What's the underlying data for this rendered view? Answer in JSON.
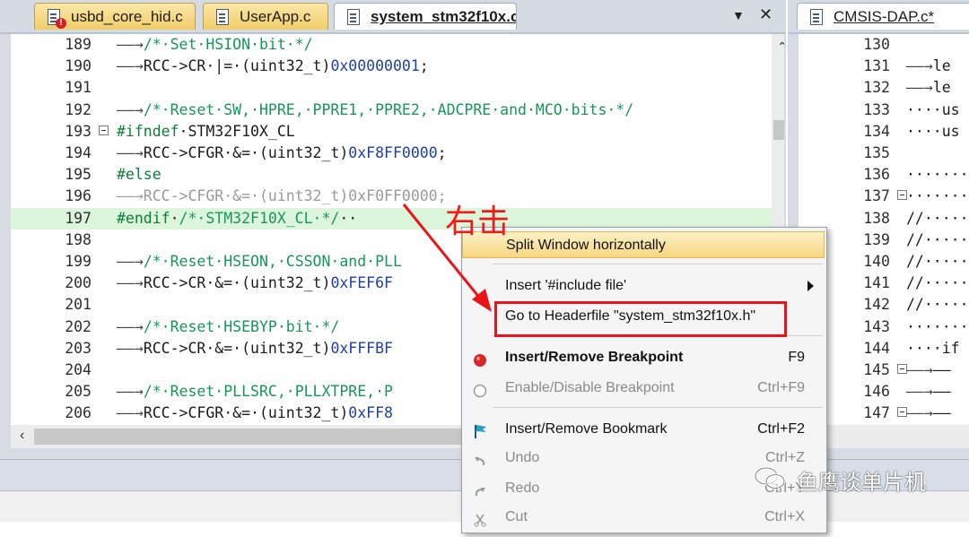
{
  "left_editor": {
    "tabs": [
      {
        "label": "usbd_core_hid.c",
        "icon": "c-file-error-icon"
      },
      {
        "label": "UserApp.c",
        "icon": "c-file-icon"
      },
      {
        "label": "system_stm32f10x.c",
        "icon": "c-file-icon",
        "active": true
      }
    ],
    "tab_dropdown": "▼",
    "tab_close": "✕",
    "lines": [
      {
        "num": "189",
        "code": "——→/*·Set·HSION·bit·*/"
      },
      {
        "num": "190",
        "code": "——→RCC->CR·|=·(uint32_t)0x00000001;"
      },
      {
        "num": "191",
        "code": ""
      },
      {
        "num": "192",
        "code": "——→/*·Reset·SW,·HPRE,·PPRE1,·PPRE2,·ADCPRE·and·MCO·bits·*/"
      },
      {
        "num": "193",
        "code": "#ifndef·STM32F10X_CL"
      },
      {
        "num": "194",
        "code": "——→RCC->CFGR·&=·(uint32_t)0xF8FF0000;"
      },
      {
        "num": "195",
        "code": "#else"
      },
      {
        "num": "196",
        "code": "——→RCC->CFGR·&=·(uint32_t)0xF0FF0000;"
      },
      {
        "num": "197",
        "code": "#endif·/*·STM32F10X_CL·*/··"
      },
      {
        "num": "198",
        "code": ""
      },
      {
        "num": "199",
        "code": "——→/*·Reset·HSEON,·CSSON·and·PLL"
      },
      {
        "num": "200",
        "code": "——→RCC->CR·&=·(uint32_t)0xFEF6F"
      },
      {
        "num": "201",
        "code": ""
      },
      {
        "num": "202",
        "code": "——→/*·Reset·HSEBYP·bit·*/"
      },
      {
        "num": "203",
        "code": "——→RCC->CR·&=·(uint32_t)0xFFFBF"
      },
      {
        "num": "204",
        "code": ""
      },
      {
        "num": "205",
        "code": "——→/*·Reset·PLLSRC,·PLLXTPRE,·P"
      },
      {
        "num": "206",
        "code": "——→RCC->CFGR·&=·(uint32_t)0xFF8"
      }
    ]
  },
  "right_editor": {
    "tab": {
      "label": "CMSIS-DAP.c*",
      "icon": "c-file-icon"
    },
    "lines": [
      {
        "num": "130",
        "code": ""
      },
      {
        "num": "131",
        "code": "——→le"
      },
      {
        "num": "132",
        "code": "——→le"
      },
      {
        "num": "133",
        "code": "····us"
      },
      {
        "num": "134",
        "code": "····us"
      },
      {
        "num": "135",
        "code": ""
      },
      {
        "num": "136",
        "code": "·······"
      },
      {
        "num": "137",
        "code": "·······"
      },
      {
        "num": "138",
        "code": "//·····"
      },
      {
        "num": "139",
        "code": "//·····"
      },
      {
        "num": "140",
        "code": "//·····"
      },
      {
        "num": "141",
        "code": "//·····"
      },
      {
        "num": "142",
        "code": "//·····"
      },
      {
        "num": "143",
        "code": "·······"
      },
      {
        "num": "144",
        "code": "····if"
      },
      {
        "num": "145",
        "code": "——→——"
      },
      {
        "num": "146",
        "code": "——→——"
      },
      {
        "num": "147",
        "code": "——→——"
      }
    ]
  },
  "context_menu": {
    "items": [
      {
        "label": "Split Window horizontally",
        "shortcut": "",
        "state": "highlighted"
      },
      {
        "label": "Insert '#include file'",
        "shortcut": "",
        "submenu": true
      },
      {
        "label": "Go to Headerfile \"system_stm32f10x.h\"",
        "shortcut": ""
      },
      {
        "label": "Insert/Remove Breakpoint",
        "shortcut": "F9",
        "icon": "breakpoint-icon",
        "bold": true
      },
      {
        "label": "Enable/Disable Breakpoint",
        "shortcut": "Ctrl+F9",
        "icon": "disabled-breakpoint-icon",
        "disabled": true
      },
      {
        "label": "Insert/Remove Bookmark",
        "shortcut": "Ctrl+F2",
        "icon": "bookmark-flag-icon"
      },
      {
        "label": "Undo",
        "shortcut": "Ctrl+Z",
        "icon": "undo-icon",
        "disabled": true
      },
      {
        "label": "Redo",
        "shortcut": "Ctrl+Y",
        "icon": "redo-icon",
        "disabled": true
      },
      {
        "label": "Cut",
        "shortcut": "Ctrl+X",
        "icon": "cut-icon",
        "disabled": true
      }
    ]
  },
  "annotation": {
    "text": "右击",
    "color": "#ee1b1b"
  },
  "watermark": {
    "text": "鱼鹰谈单片机"
  },
  "colors": {
    "accent": "#f6d680",
    "highlight_line": "#dcf6dc",
    "annotation_box": "#e8141a"
  }
}
